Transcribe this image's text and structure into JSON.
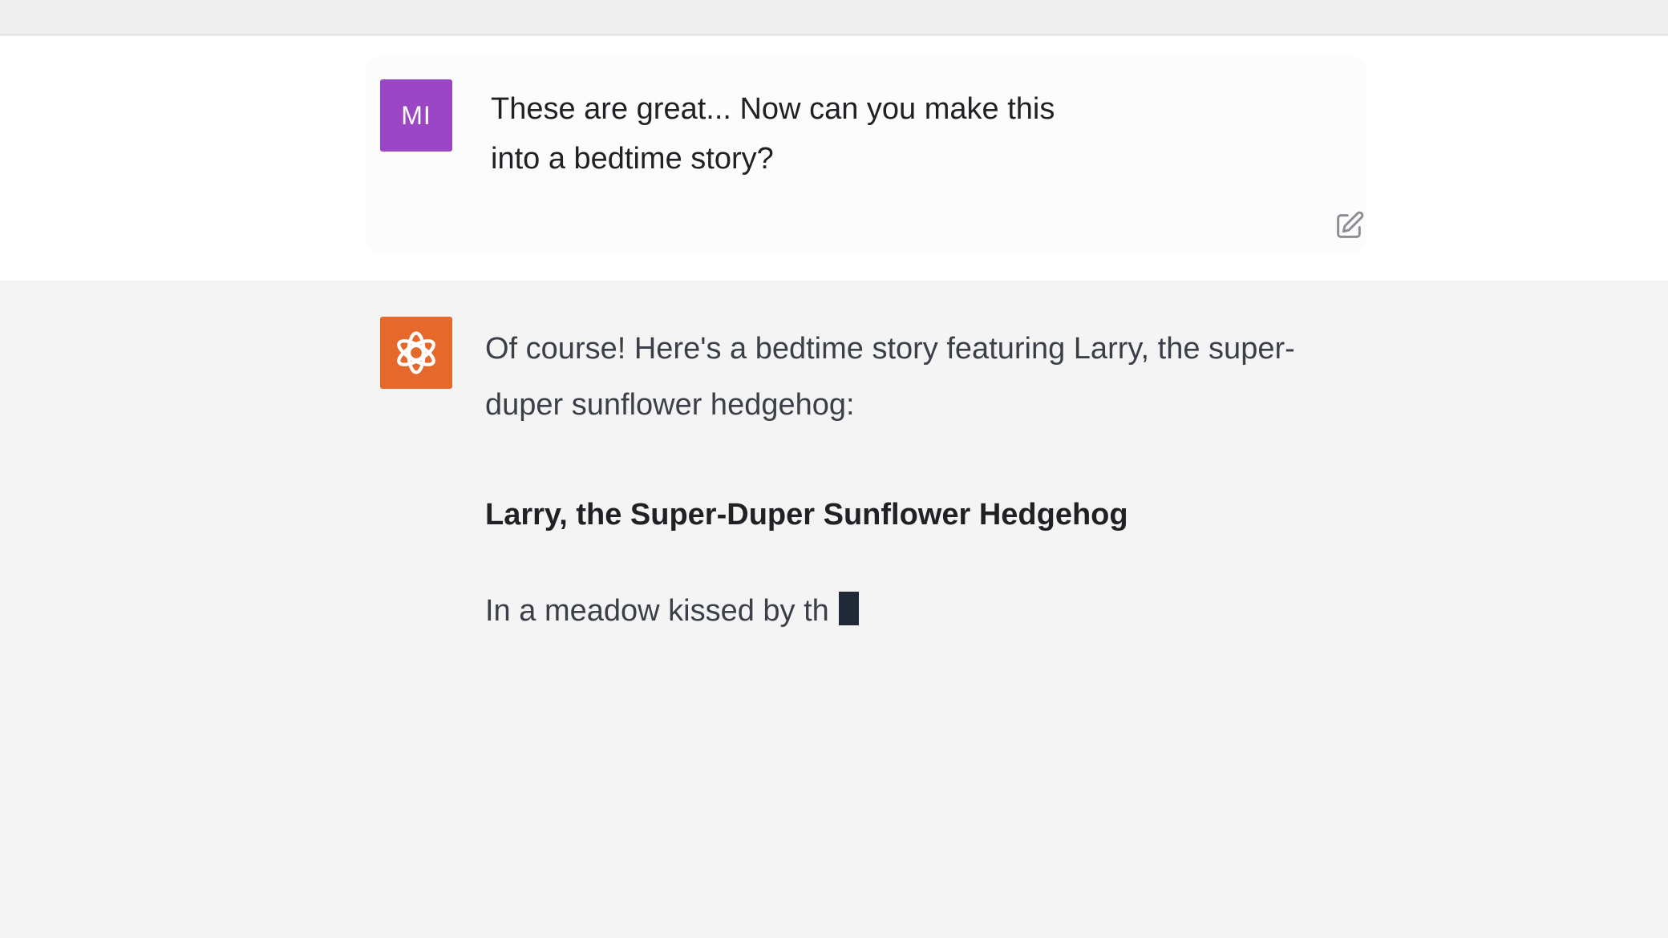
{
  "user_message": {
    "avatar_initials": "MI",
    "text": "These are great... Now can you make this into a bedtime story?"
  },
  "assistant_message": {
    "intro": "Of course! Here's a bedtime story featuring Larry, the super-duper sunflower hedgehog:",
    "story_title": "Larry, the Super-Duper Sunflower Hedgehog",
    "story_text": "In a meadow kissed by th"
  },
  "icons": {
    "edit": "edit-icon",
    "assistant_logo": "openai-logo-icon",
    "cursor": "typing-cursor"
  },
  "colors": {
    "user_avatar": "#9b46c4",
    "assistant_avatar": "#e4692a",
    "assistant_background": "#f4f4f5",
    "user_background": "#ffffff"
  }
}
